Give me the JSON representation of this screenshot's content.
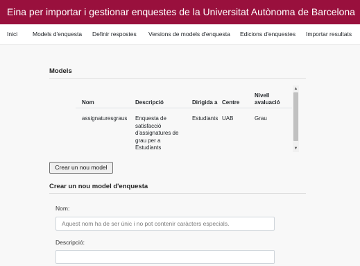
{
  "header": {
    "title": "Eina per importar i gestionar enquestes de la Universitat Autònoma de Barcelona"
  },
  "nav": {
    "items": [
      "Inici",
      "Models d'enquesta",
      "Definir respostes",
      "Versions de models d'enquesta",
      "Edicions d'enquestes",
      "Importar resultats"
    ]
  },
  "models": {
    "title": "Models",
    "columns": [
      "Nom",
      "Descripció",
      "Dirigida a",
      "Centre",
      "Nivell avaluació"
    ],
    "rows": [
      {
        "nom": "assignaturesgraus",
        "descripcio": "Enquesta de satisfacció d'assignatures de grau per a Estudiants",
        "dirigida": "Estudiants",
        "centre": "UAB",
        "nivell": "Grau"
      }
    ],
    "create_button": "Crear un nou model"
  },
  "form": {
    "title": "Crear un nou model d'enquesta",
    "nom_label": "Nom:",
    "nom_placeholder": "Aquest nom ha de ser únic i no pot contenir caràcters especials.",
    "nom_value": "",
    "descripcio_label": "Descripció:",
    "descripcio_value": ""
  },
  "colors": {
    "header_bg": "#99103d",
    "header_text": "#ffffff"
  }
}
